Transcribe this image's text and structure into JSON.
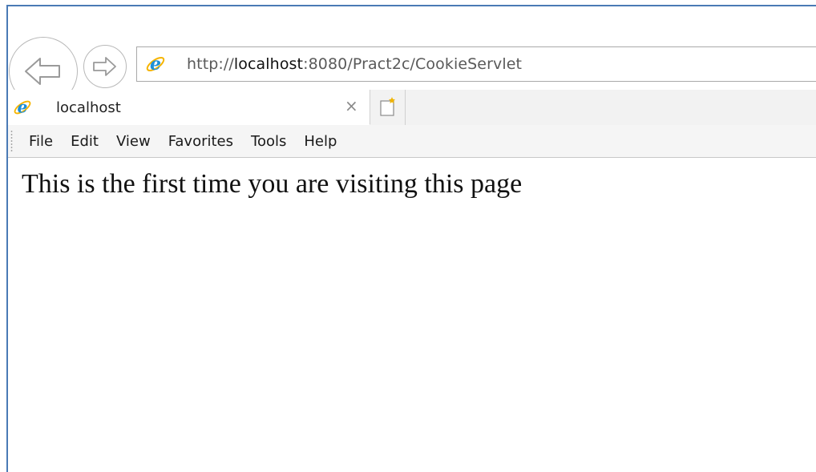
{
  "address_bar": {
    "url_prefix": "http://",
    "url_host": "localhost",
    "url_rest": ":8080/Pract2c/CookieServlet",
    "icon": "ie-icon"
  },
  "tab": {
    "title": "localhost",
    "close_glyph": "×",
    "icon": "ie-icon"
  },
  "new_tab_icon": "new-tab-icon",
  "menu": {
    "items": [
      "File",
      "Edit",
      "View",
      "Favorites",
      "Tools",
      "Help"
    ]
  },
  "page": {
    "message": "This is the first time you are visiting this page"
  },
  "colors": {
    "frame_border": "#4a7ab5",
    "ie_blue": "#1d8fd8",
    "ie_gold": "#f5b400"
  }
}
